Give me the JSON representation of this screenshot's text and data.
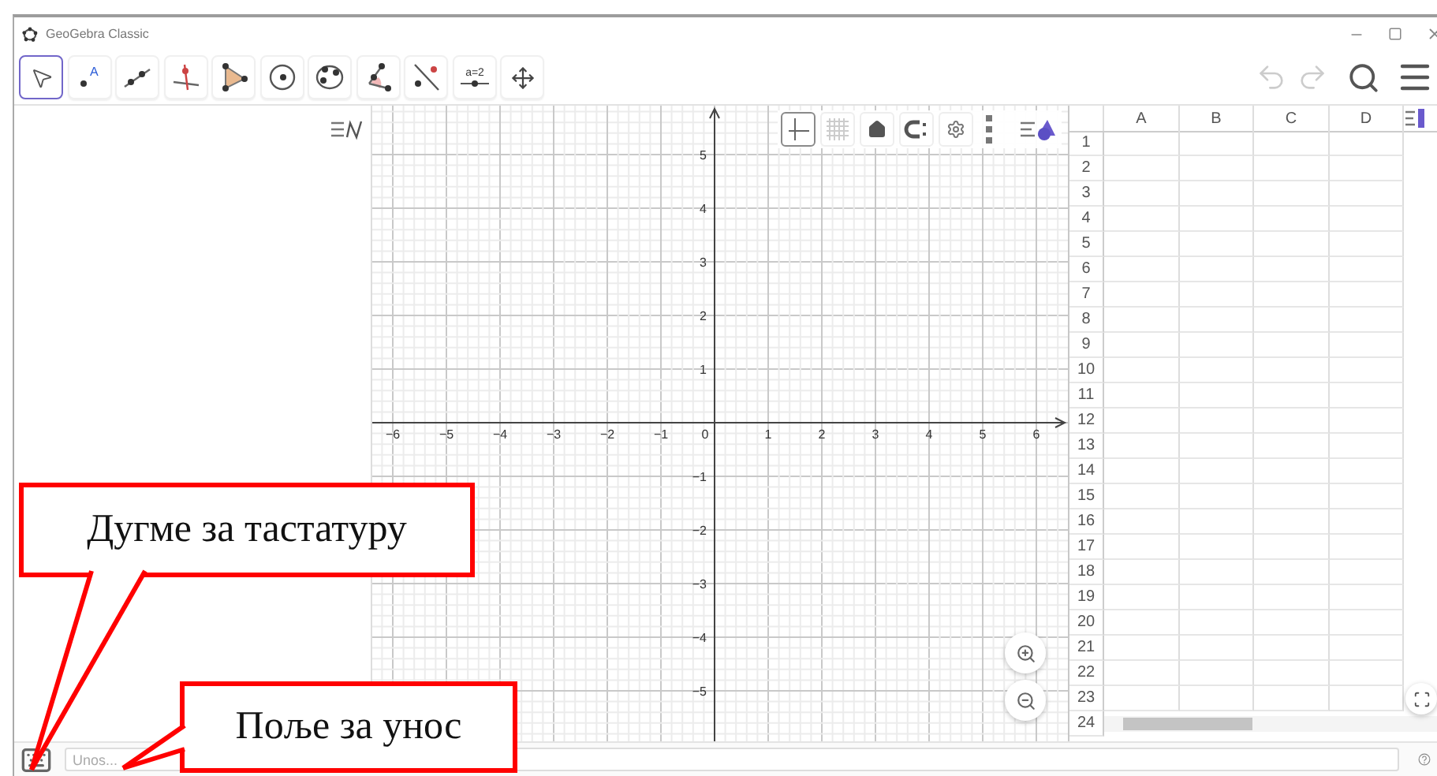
{
  "window": {
    "title": "GeoGebra Classic"
  },
  "toolbar": {
    "tools": [
      {
        "kind": "move",
        "selected": true
      },
      {
        "kind": "point",
        "label": "A",
        "selected": false
      },
      {
        "kind": "line",
        "selected": false
      },
      {
        "kind": "perpendicular",
        "selected": false
      },
      {
        "kind": "polygon",
        "selected": false
      },
      {
        "kind": "circle",
        "selected": false
      },
      {
        "kind": "conic",
        "selected": false
      },
      {
        "kind": "angle",
        "selected": false
      },
      {
        "kind": "reflect",
        "selected": false
      },
      {
        "kind": "slider",
        "label": "a=2",
        "selected": false
      },
      {
        "kind": "move-view",
        "selected": false
      }
    ]
  },
  "graphics": {
    "style_bar": [
      {
        "kind": "axes",
        "selected": true
      },
      {
        "kind": "grid",
        "selected": false
      }
    ],
    "x_axis": {
      "negative_labels": [
        "−6",
        "−5",
        "−4",
        "−3",
        "−2",
        "−1"
      ],
      "origin_label": "0",
      "positive_labels": [
        "1",
        "2",
        "3",
        "4",
        "5",
        "6"
      ]
    },
    "y_axis": {
      "positive_labels": [
        "5",
        "4",
        "3",
        "2",
        "1"
      ],
      "negative_labels": [
        "−1",
        "−2",
        "−3",
        "−4",
        "−5"
      ]
    }
  },
  "spreadsheet": {
    "columns": [
      "A",
      "B",
      "C",
      "D"
    ],
    "rows": [
      "1",
      "2",
      "3",
      "4",
      "5",
      "6",
      "7",
      "8",
      "9",
      "10",
      "11",
      "12",
      "13",
      "14",
      "15",
      "16",
      "17",
      "18",
      "19",
      "20",
      "21",
      "22",
      "23",
      "24"
    ]
  },
  "input_bar": {
    "placeholder": "Unos..."
  },
  "callouts": [
    {
      "kind": "keyboard",
      "text": "Дугме за тастатуру"
    },
    {
      "kind": "input",
      "text": "Поље за унос"
    }
  ]
}
